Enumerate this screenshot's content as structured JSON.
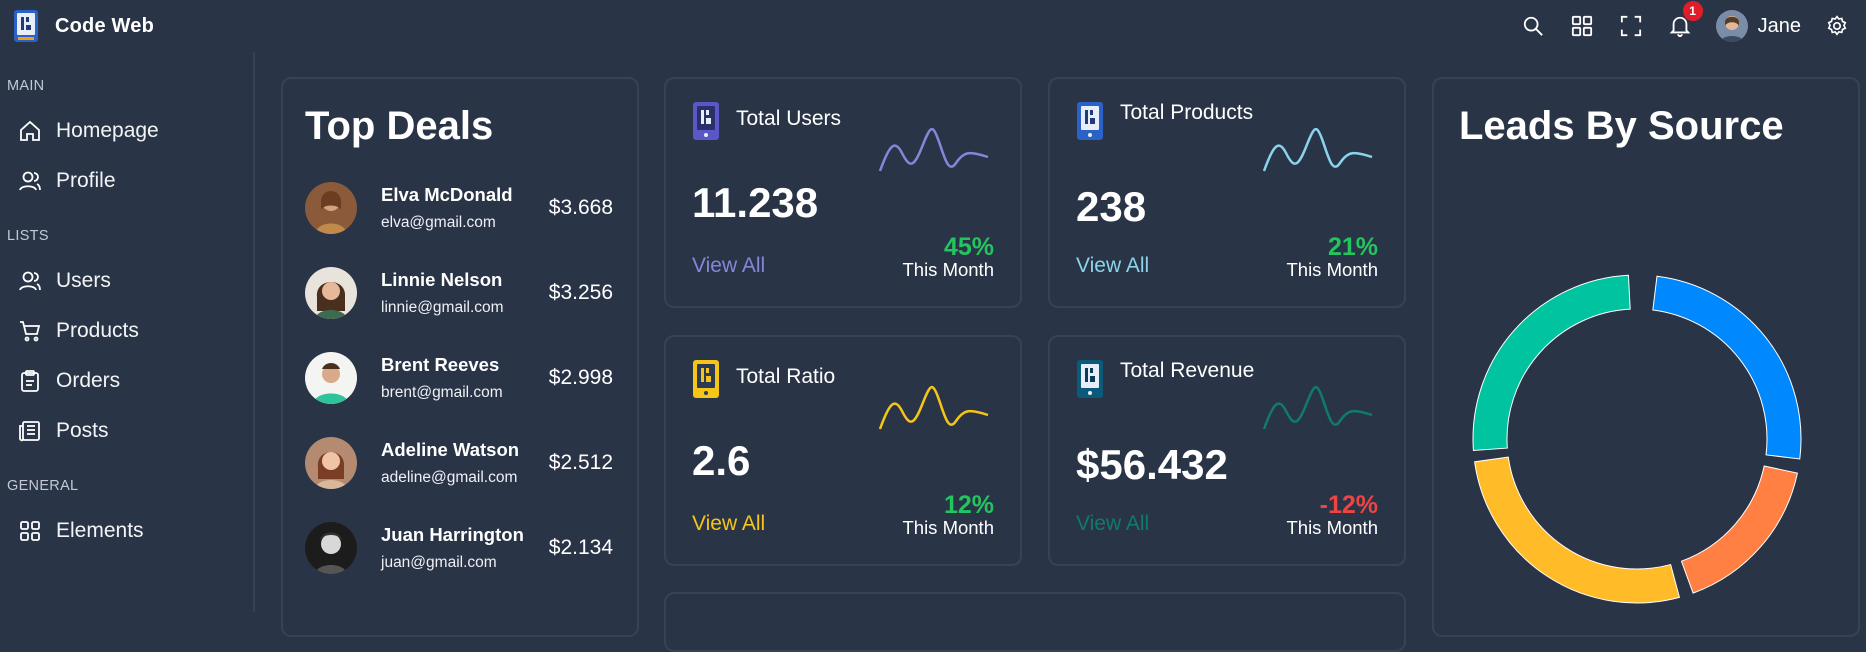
{
  "app": {
    "title": "Code Web"
  },
  "header": {
    "icons": [
      "search-icon",
      "grid-icon",
      "fullscreen-icon",
      "bell-icon",
      "settings-icon"
    ],
    "notification_count": "1",
    "user_name": "Jane"
  },
  "sidebar": {
    "sections": [
      {
        "title": "MAIN",
        "items": [
          {
            "label": "Homepage",
            "icon": "home-icon"
          },
          {
            "label": "Profile",
            "icon": "user-icon"
          }
        ]
      },
      {
        "title": "LISTS",
        "items": [
          {
            "label": "Users",
            "icon": "user-icon"
          },
          {
            "label": "Products",
            "icon": "cart-icon"
          },
          {
            "label": "Orders",
            "icon": "clipboard-icon"
          },
          {
            "label": "Posts",
            "icon": "newspaper-icon"
          }
        ]
      },
      {
        "title": "GENERAL",
        "items": [
          {
            "label": "Elements",
            "icon": "elements-icon"
          }
        ]
      }
    ]
  },
  "top_deals": {
    "title": "Top Deals",
    "rows": [
      {
        "name": "Elva McDonald",
        "email": "elva@gmail.com",
        "amount": "$3.668"
      },
      {
        "name": "Linnie Nelson",
        "email": "linnie@gmail.com",
        "amount": "$3.256"
      },
      {
        "name": "Brent Reeves",
        "email": "brent@gmail.com",
        "amount": "$2.998"
      },
      {
        "name": "Adeline Watson",
        "email": "adeline@gmail.com",
        "amount": "$2.512"
      },
      {
        "name": "Juan Harrington",
        "email": "juan@gmail.com",
        "amount": "$2.134"
      }
    ]
  },
  "stats": {
    "users": {
      "title": "Total Users",
      "value": "11.238",
      "link": "View All",
      "pct": "45%",
      "period": "This Month",
      "color": "#8884d8",
      "pct_color": "#22c55e"
    },
    "products": {
      "title": "Total Products",
      "value": "238",
      "link": "View All",
      "pct": "21%",
      "period": "This Month",
      "color": "#8ad3ea",
      "pct_color": "#22c55e"
    },
    "ratio": {
      "title": "Total Ratio",
      "value": "2.6",
      "link": "View All",
      "pct": "12%",
      "period": "This Month",
      "color": "#f5c518",
      "pct_color": "#22c55e"
    },
    "revenue": {
      "title": "Total Revenue",
      "value": "$56.432",
      "link": "View All",
      "pct": "-12%",
      "period": "This Month",
      "color": "#0f7a6e",
      "pct_color": "#ef4444"
    }
  },
  "leads": {
    "title": "Leads By Source",
    "colors": [
      "#0088fe",
      "#ff8042",
      "#ffbb28",
      "#00c49f"
    ]
  }
}
